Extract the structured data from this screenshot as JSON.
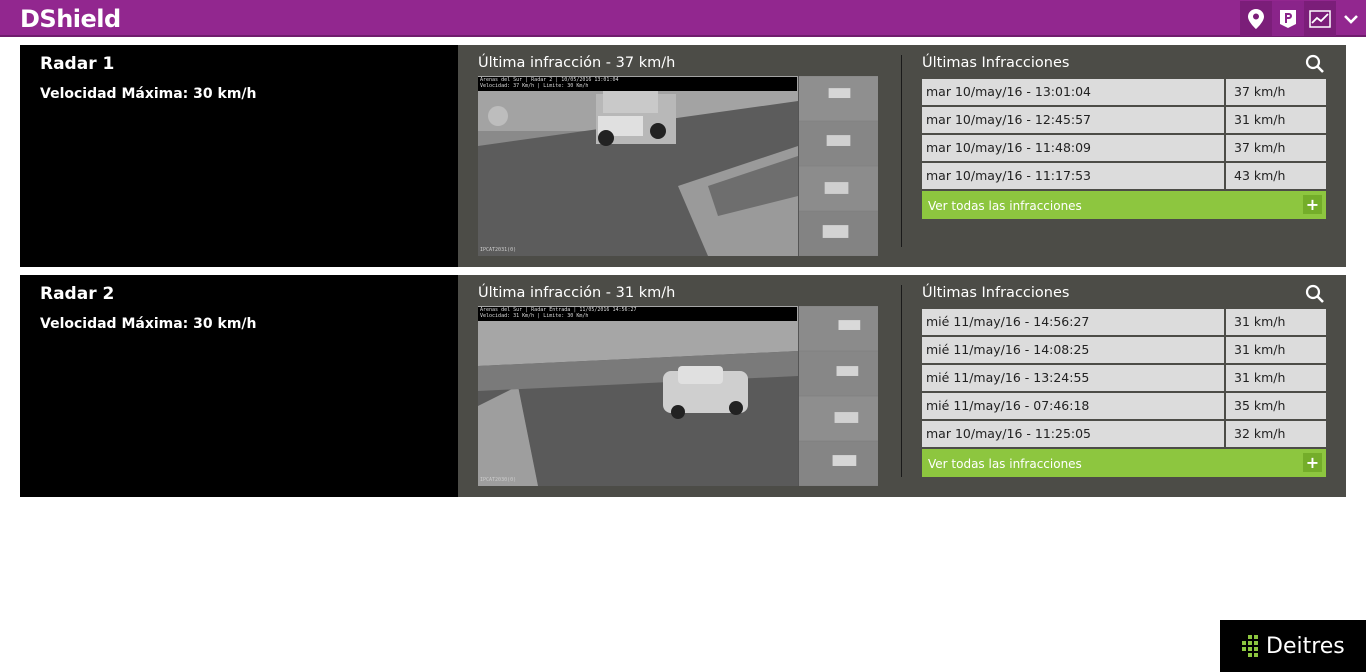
{
  "header": {
    "brand": "DShield",
    "icons": [
      "location-pin-icon",
      "parking-icon",
      "chart-line-icon",
      "chevron-down-icon"
    ],
    "accent": "#92278f"
  },
  "radars": [
    {
      "name": "Radar 1",
      "max_speed": "Velocidad Máxima: 30 km/h",
      "last_title": "Última infracción - 37 km/h",
      "photo_overlay_line1": "Arenas del Sur | Radar 2 | 10/05/2016 13:01:04",
      "photo_overlay_line2": "Velocidad: 37 Km/h | Limite: 30 Km/h",
      "photo_watermark": "IPCAT2031(0)",
      "list_title": "Últimas Infracciones",
      "rows": [
        {
          "date": "mar 10/may/16 - 13:01:04",
          "speed": "37 km/h"
        },
        {
          "date": "mar 10/may/16 - 12:45:57",
          "speed": "31 km/h"
        },
        {
          "date": "mar 10/may/16 - 11:48:09",
          "speed": "37 km/h"
        },
        {
          "date": "mar 10/may/16 - 11:17:53",
          "speed": "43 km/h"
        }
      ],
      "see_all": "Ver todas las infracciones"
    },
    {
      "name": "Radar 2",
      "max_speed": "Velocidad Máxima: 30 km/h",
      "last_title": "Última infracción - 31 km/h",
      "photo_overlay_line1": "Arenas del Sur | Radar Entrada | 11/05/2016 14:56:27",
      "photo_overlay_line2": "Velocidad: 31 Km/h | Limite: 30 Km/h",
      "photo_watermark": "IPCAT2030(0)",
      "list_title": "Últimas Infracciones",
      "rows": [
        {
          "date": "mié 11/may/16 - 14:56:27",
          "speed": "31 km/h"
        },
        {
          "date": "mié 11/may/16 - 14:08:25",
          "speed": "31 km/h"
        },
        {
          "date": "mié 11/may/16 - 13:24:55",
          "speed": "31 km/h"
        },
        {
          "date": "mié 11/may/16 - 07:46:18",
          "speed": "35 km/h"
        },
        {
          "date": "mar 10/may/16 - 11:25:05",
          "speed": "32 km/h"
        }
      ],
      "see_all": "Ver todas las infracciones"
    }
  ],
  "footer": {
    "logo_text": "Deitres",
    "logo_color": "#8dc63f"
  },
  "colors": {
    "panel_bg": "#4c4c47",
    "row_bg": "#dcdcdc",
    "action_green": "#8dc63f"
  }
}
